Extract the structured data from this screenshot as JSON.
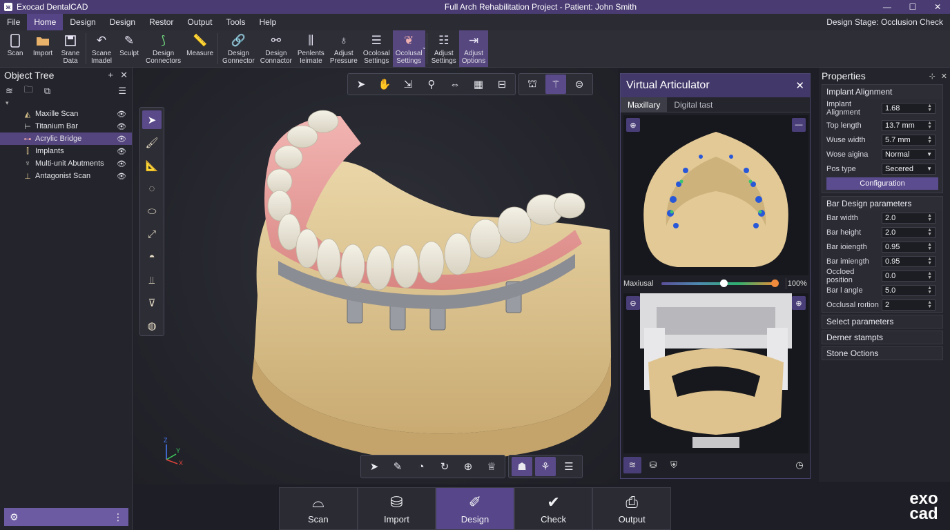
{
  "titlebar": {
    "app_name": "Exocad DentalCAD",
    "document_title": "Full Arch Rehabilitation Project - Patient: John Smith",
    "minimize": "—",
    "maximize": "☐",
    "close": "✕"
  },
  "menu": {
    "items": [
      "File",
      "Home",
      "Design",
      "Design",
      "Restor",
      "Output",
      "Tools",
      "Help"
    ],
    "active_index": 1,
    "stage_label": "Design Stage: Occlusion Check"
  },
  "ribbon": {
    "buttons": [
      {
        "label": "Scan",
        "icon": "scan-icon"
      },
      {
        "label": "Import",
        "icon": "folder-icon"
      },
      {
        "label": "Srane\nData",
        "icon": "save-icon"
      },
      {
        "label": "Scane\nImadel",
        "icon": "undo-icon"
      },
      {
        "label": "Sculpt",
        "icon": "sculpt-icon"
      },
      {
        "label": "Design\nConnectors",
        "icon": "connector-icon"
      },
      {
        "label": "Measure",
        "icon": "ruler-icon"
      },
      {
        "label": "Design\nGonnector",
        "icon": "link-icon"
      },
      {
        "label": "Design\nConnactor",
        "icon": "nodes-icon"
      },
      {
        "label": "Penlents\nIeimate",
        "icon": "implant-icon"
      },
      {
        "label": "Adjust\nPressure",
        "icon": "tooth-icon"
      },
      {
        "label": "Ocolosal\nSettings",
        "icon": "sliders-icon"
      },
      {
        "label": "Ocolusal\nSettings",
        "icon": "tooth-settings-icon"
      },
      {
        "label": "Adjust\nSettings",
        "icon": "adjust-icon"
      },
      {
        "label": "Adjust\nOptions",
        "icon": "export-icon"
      }
    ]
  },
  "object_tree": {
    "title": "Object Tree",
    "pin": "+",
    "close": "✕",
    "items": [
      {
        "label": "Maxille Scan",
        "selected": false
      },
      {
        "label": "Titanium Bar",
        "selected": false
      },
      {
        "label": "Acrylic Bridge",
        "selected": true
      },
      {
        "label": "Implants",
        "selected": false
      },
      {
        "label": "Multi-unit Abutments",
        "selected": false
      },
      {
        "label": "Antagonist Scan",
        "selected": false
      }
    ],
    "footer_more": "⋮"
  },
  "viewport": {
    "axes": {
      "z": "Z",
      "y": "Y",
      "x": "X"
    }
  },
  "articulator": {
    "title": "Virtual Articulator",
    "close": "✕",
    "tabs": [
      "Maxillary",
      "Digital tast"
    ],
    "active_tab": 0,
    "slider_label": "Maxiusal",
    "slider_value": 100,
    "slider_pct": "100%"
  },
  "properties": {
    "title": "Properties",
    "pin": "⊹",
    "close": "✕",
    "implant_section": {
      "title": "Implant Alignment",
      "rows": [
        {
          "label": "Implant Alignment",
          "value": "1.68",
          "control": "spin"
        },
        {
          "label": "Top length",
          "value": "13.7 mm",
          "control": "spin"
        },
        {
          "label": "Wuse width",
          "value": "5.7 mm",
          "control": "spin"
        },
        {
          "label": "Wose aigina",
          "value": "Normal",
          "control": "dropdown"
        },
        {
          "label": "Pos type",
          "value": "Secered",
          "control": "dropdown"
        }
      ],
      "button": "Configuration"
    },
    "bar_section": {
      "title": "Bar Design parameters",
      "rows": [
        {
          "label": "Bar width",
          "value": "2.0"
        },
        {
          "label": "Bar height",
          "value": "2.0"
        },
        {
          "label": "Bar ioiength",
          "value": "0.95"
        },
        {
          "label": "Bar imiength",
          "value": "0.95"
        },
        {
          "label": "Occloed position",
          "value": "0.0"
        },
        {
          "label": "Bar l angle",
          "value": "5.0"
        },
        {
          "label": "Occlusal roıtion",
          "value": "2"
        }
      ]
    },
    "collapsed_sections": [
      "Select parameters",
      "Derner stampts",
      "Stone Octions"
    ]
  },
  "workflow": {
    "steps": [
      {
        "label": "Scan",
        "active": false
      },
      {
        "label": "Import",
        "active": false
      },
      {
        "label": "Design",
        "active": true
      },
      {
        "label": "Check",
        "active": false
      },
      {
        "label": "Output",
        "active": false
      }
    ]
  },
  "brand": {
    "line1": "exo",
    "line2": "cad"
  },
  "colors": {
    "accent": "#57478a",
    "titlebar": "#4a3c73",
    "panel": "#24252c",
    "model_stone": "#e2c896",
    "gingiva": "#e7a0a0"
  }
}
